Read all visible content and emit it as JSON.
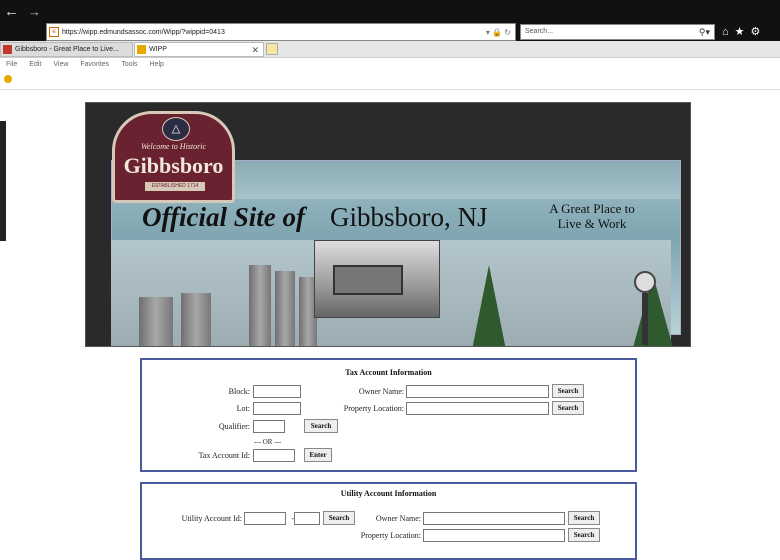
{
  "browser": {
    "url": "https://wipp.edmundsassoc.com/Wipp/?wippid=0413",
    "search_placeholder": "Search...",
    "tabs": [
      {
        "label": "Gibbsboro - Great Place to Live..."
      },
      {
        "label": "WIPP"
      }
    ],
    "menu": [
      "File",
      "Edit",
      "View",
      "Favorites",
      "Tools",
      "Help"
    ]
  },
  "banner": {
    "logo_welcome": "Welcome to Historic",
    "logo_name": "Gibbsboro",
    "logo_est": "ESTABLISHED 1714",
    "official": "Official Site of",
    "town": "Gibbsboro, NJ",
    "motto_line1": "A Great Place to",
    "motto_line2": "Live & Work"
  },
  "tax": {
    "title": "Tax Account Information",
    "block_label": "Block:",
    "lot_label": "Lot:",
    "qualifier_label": "Qualifier:",
    "or_text": "--- OR ---",
    "taxid_label": "Tax Account Id:",
    "owner_label": "Owner Name:",
    "location_label": "Property Location:",
    "search": "Search",
    "enter": "Enter"
  },
  "utility": {
    "title": "Utility Account Information",
    "account_label": "Utility Account Id:",
    "dash": "-",
    "owner_label": "Owner Name:",
    "location_label": "Property Location:",
    "search": "Search"
  }
}
